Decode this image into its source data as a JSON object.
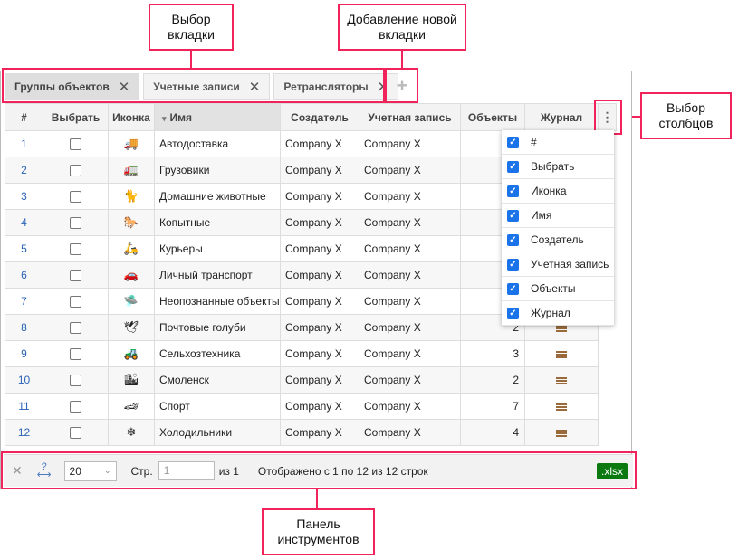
{
  "annotations": {
    "tab_select": "Выбор вкладки",
    "add_tab": "Добавление новой вкладки",
    "column_select": "Выбор столбцов",
    "toolbar": "Панель инструментов"
  },
  "tabs": [
    {
      "label": "Группы объектов",
      "active": true
    },
    {
      "label": "Учетные записи"
    },
    {
      "label": "Ретрансляторы"
    }
  ],
  "add_tab_label": "+",
  "close_glyph": "✕",
  "columns": [
    "#",
    "Выбрать",
    "Иконка",
    "Имя",
    "Создатель",
    "Учетная запись",
    "Объекты",
    "Журнал"
  ],
  "sorted_column": "Имя",
  "sort_glyph": "▾",
  "rows": [
    {
      "n": "1",
      "icon": "🚚",
      "name": "Автодоставка",
      "creator": "Company X",
      "account": "Company X",
      "objects": "2"
    },
    {
      "n": "2",
      "icon": "🚛",
      "name": "Грузовики",
      "creator": "Company X",
      "account": "Company X",
      "objects": "2"
    },
    {
      "n": "3",
      "icon": "🐈",
      "name": "Домашние животные",
      "creator": "Company X",
      "account": "Company X",
      "objects": "1"
    },
    {
      "n": "4",
      "icon": "🐎",
      "name": "Копытные",
      "creator": "Company X",
      "account": "Company X",
      "objects": "1"
    },
    {
      "n": "5",
      "icon": "🛵",
      "name": "Курьеры",
      "creator": "Company X",
      "account": "Company X",
      "objects": "3"
    },
    {
      "n": "6",
      "icon": "🚗",
      "name": "Личный транспорт",
      "creator": "Company X",
      "account": "Company X",
      "objects": "4"
    },
    {
      "n": "7",
      "icon": "🛸",
      "name": "Неопознанные объекты",
      "creator": "Company X",
      "account": "Company X",
      "objects": "1"
    },
    {
      "n": "8",
      "icon": "🕊",
      "name": "Почтовые голуби",
      "creator": "Company X",
      "account": "Company X",
      "objects": "2"
    },
    {
      "n": "9",
      "icon": "🚜",
      "name": "Сельхозтехника",
      "creator": "Company X",
      "account": "Company X",
      "objects": "3"
    },
    {
      "n": "10",
      "icon": "🏙",
      "name": "Смоленск",
      "creator": "Company X",
      "account": "Company X",
      "objects": "2"
    },
    {
      "n": "11",
      "icon": "🏎",
      "name": "Спорт",
      "creator": "Company X",
      "account": "Company X",
      "objects": "7"
    },
    {
      "n": "12",
      "icon": "❄",
      "name": "Холодильники",
      "creator": "Company X",
      "account": "Company X",
      "objects": "4"
    }
  ],
  "column_menu": {
    "button_glyph": "⋮",
    "items": [
      {
        "label": "#",
        "checked": true
      },
      {
        "label": "Выбрать",
        "checked": true
      },
      {
        "label": "Иконка",
        "checked": true
      },
      {
        "label": "Имя",
        "checked": true
      },
      {
        "label": "Создатель",
        "checked": true
      },
      {
        "label": "Учетная запись",
        "checked": true
      },
      {
        "label": "Объекты",
        "checked": true
      },
      {
        "label": "Журнал",
        "checked": true
      }
    ]
  },
  "toolbar": {
    "clear_glyph": "✕",
    "autowidth_glyph": "?",
    "page_size": "20",
    "page_label": "Стр.",
    "page_value": "1",
    "page_total": "из 1",
    "status": "Отображено с 1 по 12 из 12 строк",
    "export_label": ".xlsx"
  },
  "colors": {
    "accent": "#f0245a",
    "check": "#1a73e8",
    "export": "#0a7a10"
  }
}
